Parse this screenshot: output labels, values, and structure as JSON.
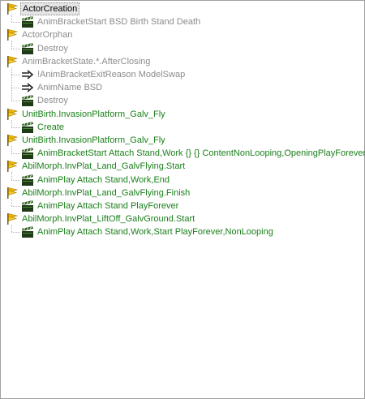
{
  "colors": {
    "active": "#1a7f1a",
    "inactive": "#8c8c8c",
    "selected_text": "#000000"
  },
  "tree": [
    {
      "type": "event",
      "label": "ActorCreation",
      "state": "selected"
    },
    {
      "type": "action",
      "label": "AnimBracketStart BSD Birth Stand Death",
      "state": "inactive"
    },
    {
      "type": "event",
      "label": "ActorOrphan",
      "state": "inactive"
    },
    {
      "type": "action",
      "label": "Destroy",
      "state": "inactive"
    },
    {
      "type": "event",
      "label": "AnimBracketState.*.AfterClosing",
      "state": "inactive"
    },
    {
      "type": "term",
      "label": "!AnimBracketExitReason ModelSwap",
      "state": "inactive"
    },
    {
      "type": "term",
      "label": "AnimName BSD",
      "state": "inactive"
    },
    {
      "type": "action",
      "label": "Destroy",
      "state": "inactive"
    },
    {
      "type": "event",
      "label": "UnitBirth.InvasionPlatform_Galv_Fly",
      "state": "active"
    },
    {
      "type": "action",
      "label": "Create",
      "state": "active"
    },
    {
      "type": "event",
      "label": "UnitBirth.InvasionPlatform_Galv_Fly",
      "state": "active"
    },
    {
      "type": "action",
      "label": "AnimBracketStart Attach Stand,Work {} {} ContentNonLooping,OpeningPlayForever",
      "state": "active"
    },
    {
      "type": "event",
      "label": "AbilMorph.InvPlat_Land_GalvFlying.Start",
      "state": "active"
    },
    {
      "type": "action",
      "label": "AnimPlay Attach Stand,Work,End",
      "state": "active"
    },
    {
      "type": "event",
      "label": "AbilMorph.InvPlat_Land_GalvFlying.Finish",
      "state": "active"
    },
    {
      "type": "action",
      "label": "AnimPlay Attach Stand PlayForever",
      "state": "active"
    },
    {
      "type": "event",
      "label": "AbilMorph.InvPlat_LiftOff_GalvGround.Start",
      "state": "active"
    },
    {
      "type": "action",
      "label": "AnimPlay Attach Stand,Work,Start PlayForever,NonLooping",
      "state": "active"
    }
  ]
}
